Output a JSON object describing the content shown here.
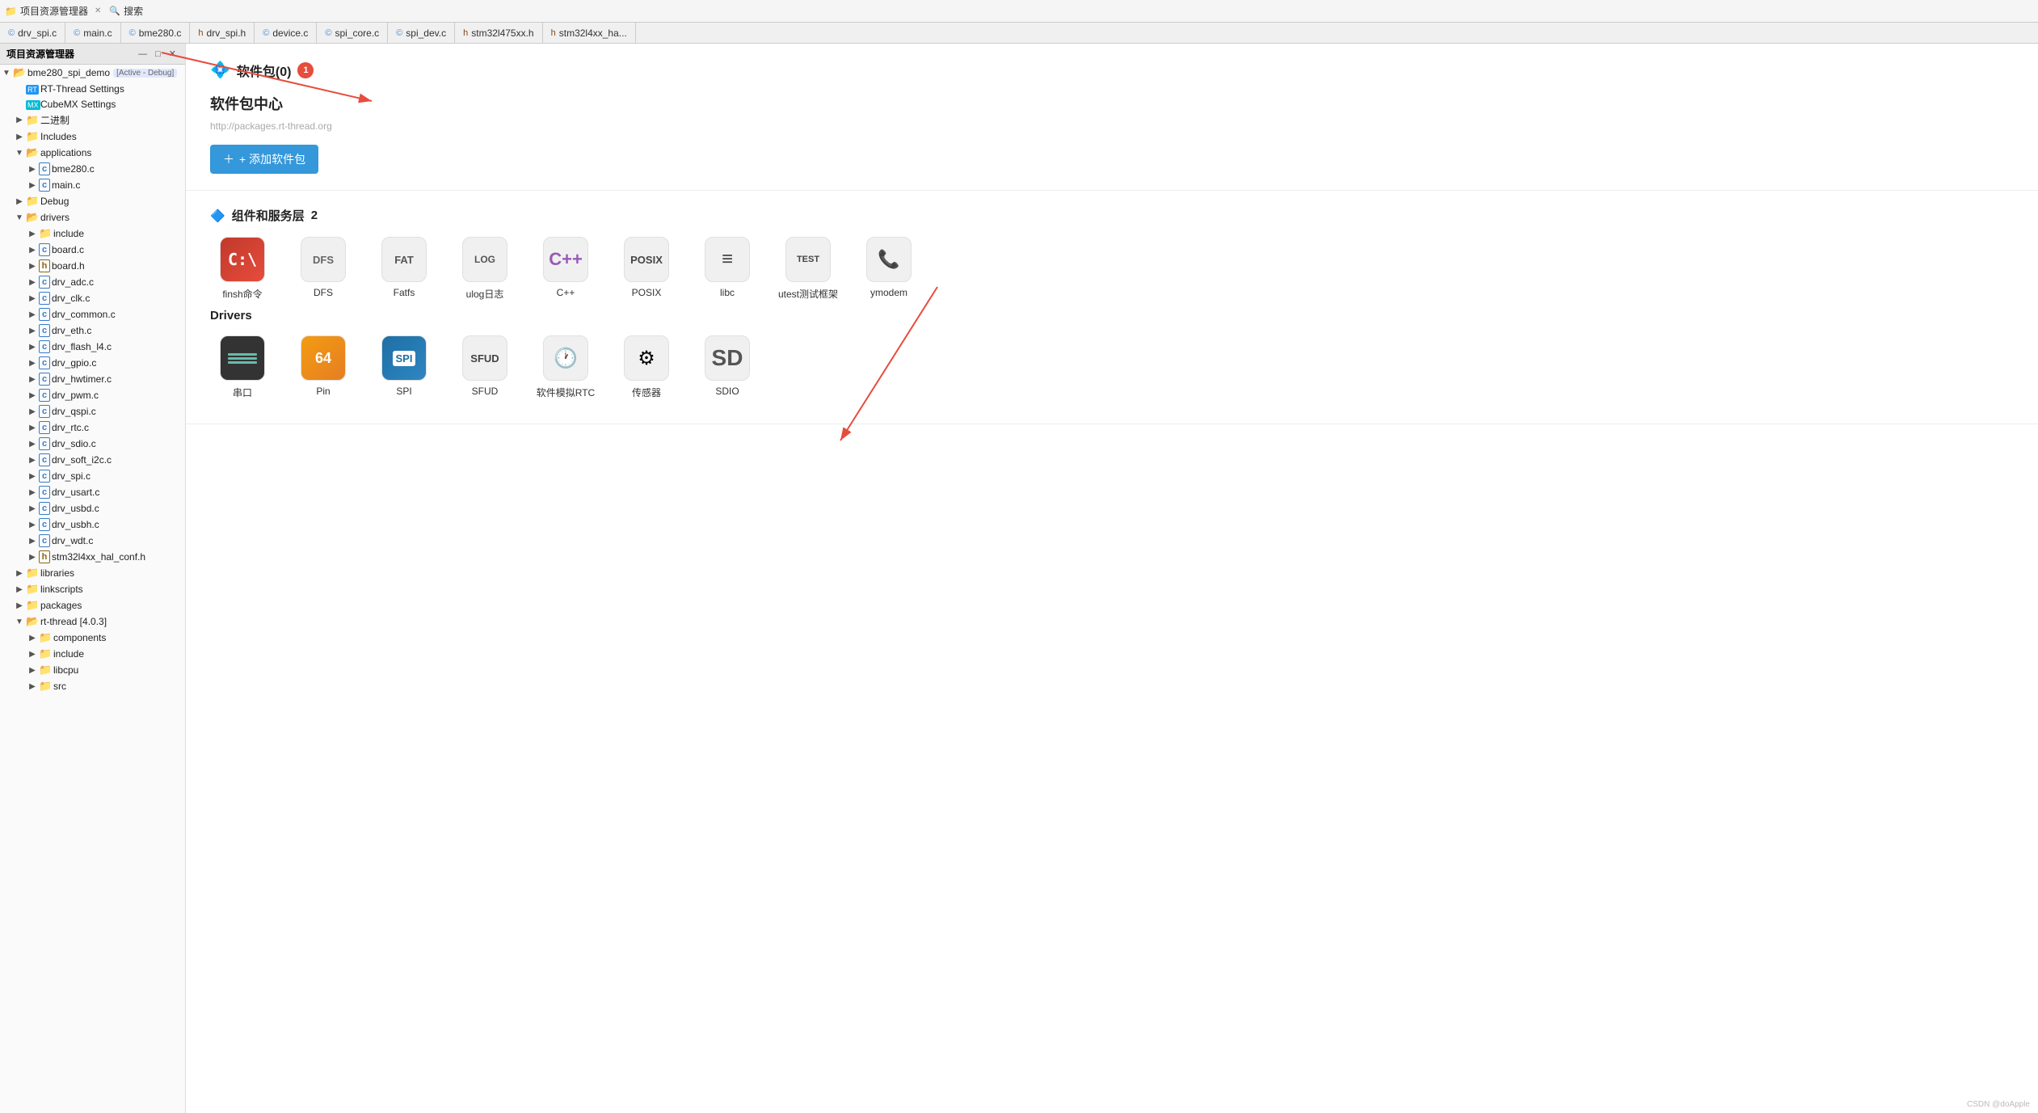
{
  "topbar": {
    "project_explorer_label": "项目资源管理器",
    "search_label": "搜索",
    "close_icon": "✕",
    "search_icon": "🔍"
  },
  "tabs": [
    {
      "label": "drv_spi.c",
      "type": "c"
    },
    {
      "label": "main.c",
      "type": "c"
    },
    {
      "label": "bme280.c",
      "type": "c"
    },
    {
      "label": "drv_spi.h",
      "type": "h"
    },
    {
      "label": "device.c",
      "type": "c"
    },
    {
      "label": "spi_core.c",
      "type": "c"
    },
    {
      "label": "spi_dev.c",
      "type": "c"
    },
    {
      "label": "stm32l475xx.h",
      "type": "h"
    },
    {
      "label": "stm32l4xx_ha...",
      "type": "h"
    }
  ],
  "sidebar": {
    "title": "项目资源管理器",
    "items": [
      {
        "level": 0,
        "arrow": "▼",
        "icon": "folder",
        "iconClass": "folder-yellow",
        "label": "bme280_spi_demo",
        "badge": "[Active - Debug]",
        "expanded": true
      },
      {
        "level": 1,
        "arrow": "",
        "icon": "rt",
        "label": "RT-Thread Settings",
        "badge": "",
        "arrow_annotation": true
      },
      {
        "level": 1,
        "arrow": "",
        "icon": "mx",
        "label": "CubeMX Settings"
      },
      {
        "level": 1,
        "arrow": "▶",
        "icon": "folder",
        "iconClass": "folder-yellow",
        "label": "二进制"
      },
      {
        "level": 1,
        "arrow": "▶",
        "icon": "folder",
        "iconClass": "folder-blue",
        "label": "Includes"
      },
      {
        "level": 1,
        "arrow": "▼",
        "icon": "folder",
        "iconClass": "folder-yellow",
        "label": "applications",
        "expanded": true
      },
      {
        "level": 2,
        "arrow": "▶",
        "icon": "file-c",
        "label": "bme280.c"
      },
      {
        "level": 2,
        "arrow": "▶",
        "icon": "file-c",
        "label": "main.c"
      },
      {
        "level": 1,
        "arrow": "▶",
        "icon": "folder",
        "iconClass": "folder-yellow",
        "label": "Debug"
      },
      {
        "level": 1,
        "arrow": "▼",
        "icon": "folder",
        "iconClass": "folder-yellow",
        "label": "drivers",
        "expanded": true
      },
      {
        "level": 2,
        "arrow": "▶",
        "icon": "folder",
        "iconClass": "folder-yellow",
        "label": "include"
      },
      {
        "level": 2,
        "arrow": "▶",
        "icon": "file-c",
        "label": "board.c"
      },
      {
        "level": 2,
        "arrow": "▶",
        "icon": "file-h",
        "label": "board.h"
      },
      {
        "level": 2,
        "arrow": "▶",
        "icon": "file-c",
        "label": "drv_adc.c"
      },
      {
        "level": 2,
        "arrow": "▶",
        "icon": "file-c",
        "label": "drv_clk.c"
      },
      {
        "level": 2,
        "arrow": "▶",
        "icon": "file-c",
        "label": "drv_common.c"
      },
      {
        "level": 2,
        "arrow": "▶",
        "icon": "file-c",
        "label": "drv_eth.c"
      },
      {
        "level": 2,
        "arrow": "▶",
        "icon": "file-c",
        "label": "drv_flash_l4.c"
      },
      {
        "level": 2,
        "arrow": "▶",
        "icon": "file-c",
        "label": "drv_gpio.c"
      },
      {
        "level": 2,
        "arrow": "▶",
        "icon": "file-c",
        "label": "drv_hwtimer.c"
      },
      {
        "level": 2,
        "arrow": "▶",
        "icon": "file-c",
        "label": "drv_pwm.c"
      },
      {
        "level": 2,
        "arrow": "▶",
        "icon": "file-c",
        "label": "drv_qspi.c"
      },
      {
        "level": 2,
        "arrow": "▶",
        "icon": "file-c",
        "label": "drv_rtc.c"
      },
      {
        "level": 2,
        "arrow": "▶",
        "icon": "file-c",
        "label": "drv_sdio.c"
      },
      {
        "level": 2,
        "arrow": "▶",
        "icon": "file-c",
        "label": "drv_soft_i2c.c"
      },
      {
        "level": 2,
        "arrow": "▶",
        "icon": "file-c",
        "label": "drv_spi.c"
      },
      {
        "level": 2,
        "arrow": "▶",
        "icon": "file-c",
        "label": "drv_usart.c"
      },
      {
        "level": 2,
        "arrow": "▶",
        "icon": "file-c",
        "label": "drv_usbd.c"
      },
      {
        "level": 2,
        "arrow": "▶",
        "icon": "file-c",
        "label": "drv_usbh.c"
      },
      {
        "level": 2,
        "arrow": "▶",
        "icon": "file-c",
        "label": "drv_wdt.c"
      },
      {
        "level": 2,
        "arrow": "▶",
        "icon": "file-h",
        "label": "stm32l4xx_hal_conf.h"
      },
      {
        "level": 1,
        "arrow": "▶",
        "icon": "folder",
        "iconClass": "folder-yellow",
        "label": "libraries"
      },
      {
        "level": 1,
        "arrow": "▶",
        "icon": "folder",
        "iconClass": "folder-yellow",
        "label": "linkscripts"
      },
      {
        "level": 1,
        "arrow": "▶",
        "icon": "folder",
        "iconClass": "folder-yellow",
        "label": "packages"
      },
      {
        "level": 1,
        "arrow": "▼",
        "icon": "folder",
        "iconClass": "folder-yellow",
        "label": "rt-thread [4.0.3]",
        "expanded": true
      },
      {
        "level": 2,
        "arrow": "▶",
        "icon": "folder",
        "iconClass": "folder-yellow",
        "label": "components"
      },
      {
        "level": 2,
        "arrow": "▶",
        "icon": "folder",
        "iconClass": "folder-yellow",
        "label": "include"
      },
      {
        "level": 2,
        "arrow": "▶",
        "icon": "folder",
        "iconClass": "folder-yellow",
        "label": "libcpu"
      },
      {
        "level": 2,
        "arrow": "▶",
        "icon": "folder",
        "iconClass": "folder-yellow",
        "label": "src"
      }
    ]
  },
  "content": {
    "software_pkg_section": {
      "title": "软件包(0)",
      "badge": "1",
      "center_title": "软件包中心",
      "url": "http://packages.rt-thread.org",
      "add_btn_label": "+ 添加软件包"
    },
    "components_section": {
      "title": "组件和服务层",
      "badge": "2",
      "icon": "🔧",
      "items": [
        {
          "label": "finsh命令",
          "icon_type": "finsh",
          "icon_text": "C:\\"
        },
        {
          "label": "DFS",
          "icon_type": "dfs",
          "icon_text": "DFS"
        },
        {
          "label": "Fatfs",
          "icon_type": "fat",
          "icon_text": "FAT"
        },
        {
          "label": "ulog日志",
          "icon_type": "ulog",
          "icon_text": "LOG"
        },
        {
          "label": "C++",
          "icon_type": "cpp",
          "icon_text": "C++"
        },
        {
          "label": "POSIX",
          "icon_type": "posix",
          "icon_text": "POSIX"
        },
        {
          "label": "libc",
          "icon_type": "libc",
          "icon_text": "≡"
        },
        {
          "label": "utest测试框架",
          "icon_type": "utest",
          "icon_text": "TEST"
        },
        {
          "label": "ymodem",
          "icon_type": "ymodem",
          "icon_text": "📞"
        }
      ]
    },
    "drivers_section": {
      "title": "Drivers",
      "items": [
        {
          "label": "串口",
          "icon_type": "serial",
          "icon_text": "▬▬▬"
        },
        {
          "label": "Pin",
          "icon_type": "pin",
          "icon_text": "64"
        },
        {
          "label": "SPI",
          "icon_type": "spi",
          "icon_text": "SPI"
        },
        {
          "label": "SFUD",
          "icon_type": "sfud",
          "icon_text": "SFUD"
        },
        {
          "label": "软件模拟RTC",
          "icon_type": "rtc",
          "icon_text": "🕐"
        },
        {
          "label": "传感器",
          "icon_type": "sensor",
          "icon_text": "⚙"
        },
        {
          "label": "SDIO",
          "icon_type": "sdio",
          "icon_text": "SD"
        }
      ]
    }
  },
  "watermark": "CSDN @doApple"
}
